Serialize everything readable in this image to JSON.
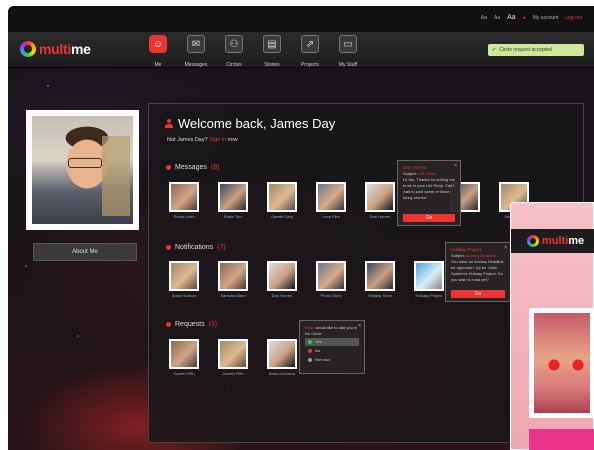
{
  "topbar": {
    "size_small": "Aa",
    "size_medium": "Aa",
    "size_large": "Aa",
    "my_account": "My account",
    "logout": "Log out"
  },
  "brand": {
    "part1": "multi",
    "part2": "me"
  },
  "nav": [
    {
      "label": "Me",
      "icon": "smiley-icon",
      "glyph": "☺"
    },
    {
      "label": "Messages",
      "icon": "envelope-icon",
      "glyph": "✉"
    },
    {
      "label": "Circles",
      "icon": "circles-icon",
      "glyph": "⚇"
    },
    {
      "label": "Stories",
      "icon": "book-icon",
      "glyph": "▤"
    },
    {
      "label": "Projects",
      "icon": "projects-icon",
      "glyph": "⇗"
    },
    {
      "label": "My Stuff",
      "icon": "box-icon",
      "glyph": "▭"
    }
  ],
  "notice": {
    "text": "Circle request accepted",
    "icon": "check-icon"
  },
  "profile": {
    "about_label": "About Me"
  },
  "welcome": {
    "title": "Welcome back, James Day",
    "not_prefix": "Not James Day?",
    "sign_in": "Sign in",
    "not_suffix": "now"
  },
  "messages": {
    "title": "Messages",
    "count": "(8)",
    "people": [
      "Sonia Lucio",
      "Robin Terr",
      "Gareth Gary",
      "Leon Flint",
      "Dan Hurren",
      "",
      "",
      "Dan Lewis"
    ],
    "popup": {
      "title": "Dan Hurren",
      "subject_label": "Subject:",
      "subject_value": "Life Story",
      "body": "Hi Jim, Thanks for adding me to be in your Life Story. Can't wait to post some of those funny stories!",
      "go": "Go"
    }
  },
  "notifications": {
    "title": "Notifications",
    "count": "(7)",
    "people": [
      "Anna Hudson",
      "Samuba Mard",
      "Dan Hurren",
      "Photo Story",
      "Holiday Story",
      "Holiday Project"
    ],
    "popup": {
      "title": "Holiday Project",
      "subject_label": "Subject:",
      "subject_value": "Access Deadline",
      "body": "You have an Access Deadline for approach. Up for Jules Sudden's Holiday Project. Do you wish to read yet?",
      "go": "Go"
    }
  },
  "requests": {
    "title": "Requests",
    "count": "(3)",
    "people": [
      "Gareth Fifth",
      "Gareth Fifth",
      "Brian McDavid"
    ],
    "popup": {
      "name": "Brian",
      "text": "would like to add you to his Circle",
      "options": [
        "Yes",
        "No",
        "Not now"
      ]
    }
  },
  "colors": {
    "accent": "#e33333",
    "notice_bg": "#cfe79b",
    "overlay_pink": "#f6c1c8",
    "magenta": "#e8338a"
  }
}
